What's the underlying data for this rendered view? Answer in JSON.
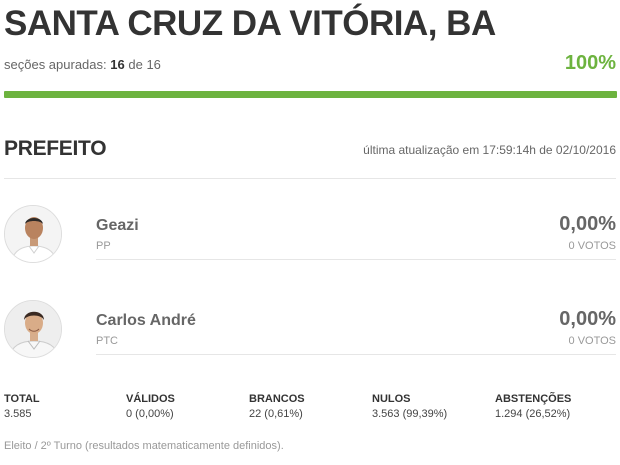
{
  "header": {
    "title": "SANTA CRUZ DA VITÓRIA, BA",
    "sections_label": "seções apuradas:",
    "sections_counted": "16",
    "sections_of": "de",
    "sections_total": "16",
    "percent": "100%",
    "progress_fraction": 1.0,
    "accent_color": "#6db33f"
  },
  "race": {
    "title": "PREFEITO",
    "last_update": "última atualização em 17:59:14h de 02/10/2016"
  },
  "candidates": [
    {
      "name": "Geazi",
      "party": "PP",
      "percent": "0,00%",
      "votes": "0 VOTOS",
      "avatar_icon": "candidate-photo"
    },
    {
      "name": "Carlos André",
      "party": "PTC",
      "percent": "0,00%",
      "votes": "0 VOTOS",
      "avatar_icon": "candidate-photo"
    }
  ],
  "stats": [
    {
      "label": "TOTAL",
      "value": "3.585"
    },
    {
      "label": "VÁLIDOS",
      "value": "0 (0,00%)"
    },
    {
      "label": "BRANCOS",
      "value": "22 (0,61%)"
    },
    {
      "label": "NULOS",
      "value": "3.563 (99,39%)"
    },
    {
      "label": "ABSTENÇÕES",
      "value": "1.294 (26,52%)"
    }
  ],
  "footnote": "Eleito / 2º Turno (resultados matematicamente definidos)."
}
